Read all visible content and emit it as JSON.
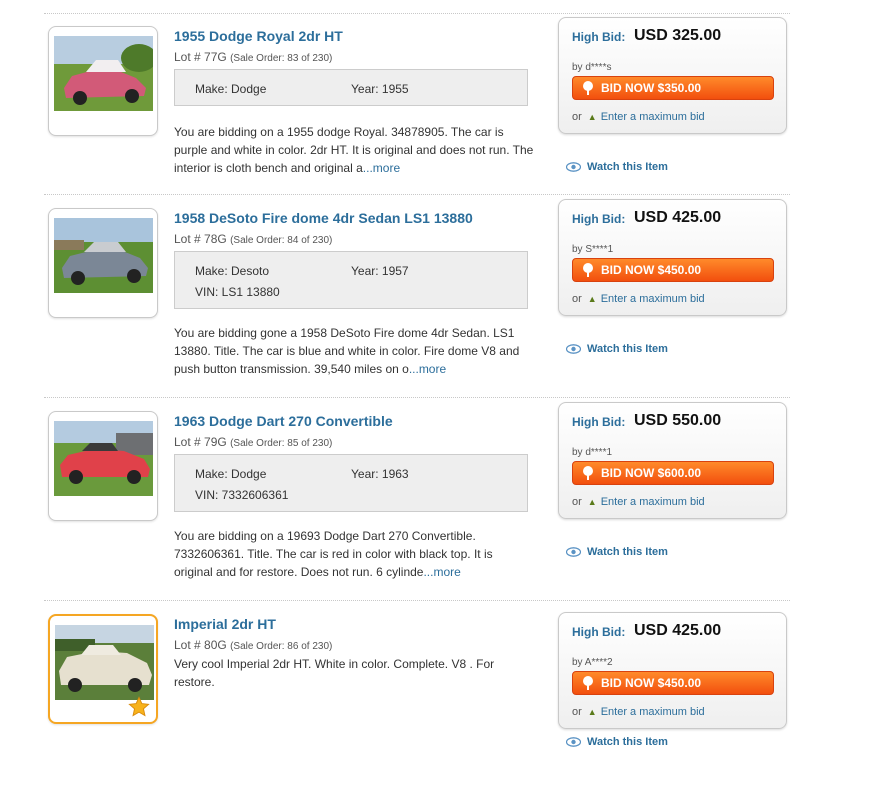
{
  "listings": [
    {
      "title": "1955 Dodge Royal 2dr HT",
      "lot": "Lot # 77G",
      "sale_order": "(Sale Order: 83 of 230)",
      "specs": {
        "make": "Make: Dodge",
        "year": "Year: 1955",
        "vin": ""
      },
      "description": "You are bidding on a 1955 dodge Royal. 34878905. The car is purple and white in color. 2dr HT. It is original and does not run. The interior is cloth bench and original a",
      "more": "...more",
      "high_bid_label": "High Bid:",
      "high_bid": "USD 325.00",
      "by": "by d****s",
      "bid_now": "BID NOW $350.00",
      "or": "or",
      "max_bid": "Enter a maximum bid",
      "watch": "Watch this Item",
      "car_color": "#d25a78",
      "roof_color": "#f2eef0"
    },
    {
      "title": "1958 DeSoto Fire dome 4dr Sedan LS1 13880",
      "lot": "Lot # 78G",
      "sale_order": "(Sale Order: 84 of 230)",
      "specs": {
        "make": "Make: Desoto",
        "year": "Year: 1957",
        "vin": "VIN: LS1 13880"
      },
      "description": "You are bidding gone a 1958 DeSoto Fire dome 4dr Sedan. LS1 13880. Title. The car is blue and white in color. Fire dome V8 and push button transmission. 39,540 miles on o",
      "more": "...more",
      "high_bid_label": "High Bid:",
      "high_bid": "USD 425.00",
      "by": "by S****1",
      "bid_now": "BID NOW $450.00",
      "or": "or",
      "max_bid": "Enter a maximum bid",
      "watch": "Watch this Item",
      "car_color": "#7b8796",
      "roof_color": "#c9ccd0"
    },
    {
      "title": "1963 Dodge Dart 270 Convertible",
      "lot": "Lot # 79G",
      "sale_order": "(Sale Order: 85 of 230)",
      "specs": {
        "make": "Make: Dodge",
        "year": "Year: 1963",
        "vin": "VIN: 7332606361"
      },
      "description": "You are bidding on a 19693 Dodge Dart 270 Convertible. 7332606361. Title. The car is red in color with black top. It is original and for restore. Does not run. 6 cylinde",
      "more": "...more",
      "high_bid_label": "High Bid:",
      "high_bid": "USD 550.00",
      "by": "by d****1",
      "bid_now": "BID NOW $600.00",
      "or": "or",
      "max_bid": "Enter a maximum bid",
      "watch": "Watch this Item",
      "car_color": "#e0414a",
      "roof_color": "#3a3a3a"
    },
    {
      "title": "Imperial 2dr HT",
      "lot": "Lot # 80G",
      "sale_order": "(Sale Order: 86 of 230)",
      "specs": null,
      "description": "Very cool Imperial 2dr HT. White in color. Complete. V8 . For restore.",
      "more": "",
      "high_bid_label": "High Bid:",
      "high_bid": "USD 425.00",
      "by": "by A****2",
      "bid_now": "BID NOW $450.00",
      "or": "or",
      "max_bid": "Enter a maximum bid",
      "watch": "Watch this Item",
      "car_color": "#e6e0cf",
      "roof_color": "#efebe0"
    }
  ],
  "colors": {
    "link": "#2c6e9b",
    "bid_button": "#f24f0e",
    "featured_border": "#f5a623"
  },
  "icons": {
    "watch": "eye-icon",
    "bid": "pin-icon",
    "max_bid": "up-arrow-icon",
    "featured": "star-icon"
  }
}
